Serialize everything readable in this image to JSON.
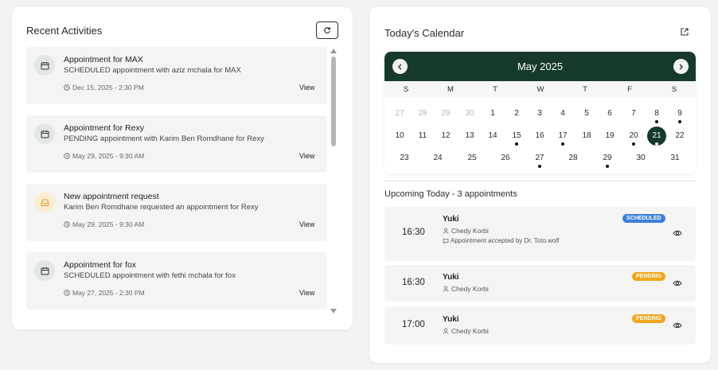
{
  "activities_panel": {
    "title": "Recent Activities",
    "items": [
      {
        "title": "Appointment for MAX",
        "description": "SCHEDULED appointment with aziz mchala for MAX",
        "datetime": "Dec 15, 2025 - 2:30 PM",
        "action": "View",
        "icon": "calendar-icon"
      },
      {
        "title": "Appointment for Rexy",
        "description": "PENDING appointment with Karim Ben Romdhane for Rexy",
        "datetime": "May 29, 2025 - 9:30 AM",
        "action": "View",
        "icon": "calendar-icon"
      },
      {
        "title": "New appointment request",
        "description": "Karim Ben Romdhane requested an appointment for Rexy",
        "datetime": "May 29, 2025 - 9:30 AM",
        "action": "View",
        "icon": "inbox-icon"
      },
      {
        "title": "Appointment for fox",
        "description": "SCHEDULED appointment with fethi mchala for fox",
        "datetime": "May 27, 2025 - 2:30 PM",
        "action": "View",
        "icon": "calendar-icon"
      }
    ]
  },
  "calendar_panel": {
    "title": "Today's Calendar",
    "month_label": "May 2025",
    "weekdays": [
      "S",
      "M",
      "T",
      "W",
      "T",
      "F",
      "S"
    ],
    "days": [
      "27",
      "28",
      "29",
      "30",
      "1",
      "2",
      "3",
      "4",
      "5",
      "6",
      "7",
      "8",
      "9",
      "10",
      "11",
      "12",
      "13",
      "14",
      "15",
      "16",
      "17",
      "18",
      "19",
      "20",
      "21",
      "22",
      "23",
      "24",
      "25",
      "26",
      "27",
      "28",
      "29",
      "30",
      "31"
    ],
    "today": "21",
    "days_with_events": [
      "8",
      "9",
      "15",
      "17",
      "20",
      "21",
      "27",
      "29"
    ]
  },
  "upcoming": {
    "title": "Upcoming Today - 3 appointments",
    "items": [
      {
        "time": "16:30",
        "pet": "Yuki",
        "owner": "Chedy Korbi",
        "status": "SCHEDULED",
        "note": "Appointment accepted by Dr. Toto.wolf"
      },
      {
        "time": "16:30",
        "pet": "Yuki",
        "owner": "Chedy Korbi",
        "status": "PENDING"
      },
      {
        "time": "17:00",
        "pet": "Yuki",
        "owner": "Chedy Korbi",
        "status": "PENDING"
      }
    ]
  },
  "colors": {
    "calendar_header": "#163a2a",
    "scheduled_badge": "#3c7fd9",
    "pending_badge": "#f1a61e"
  }
}
